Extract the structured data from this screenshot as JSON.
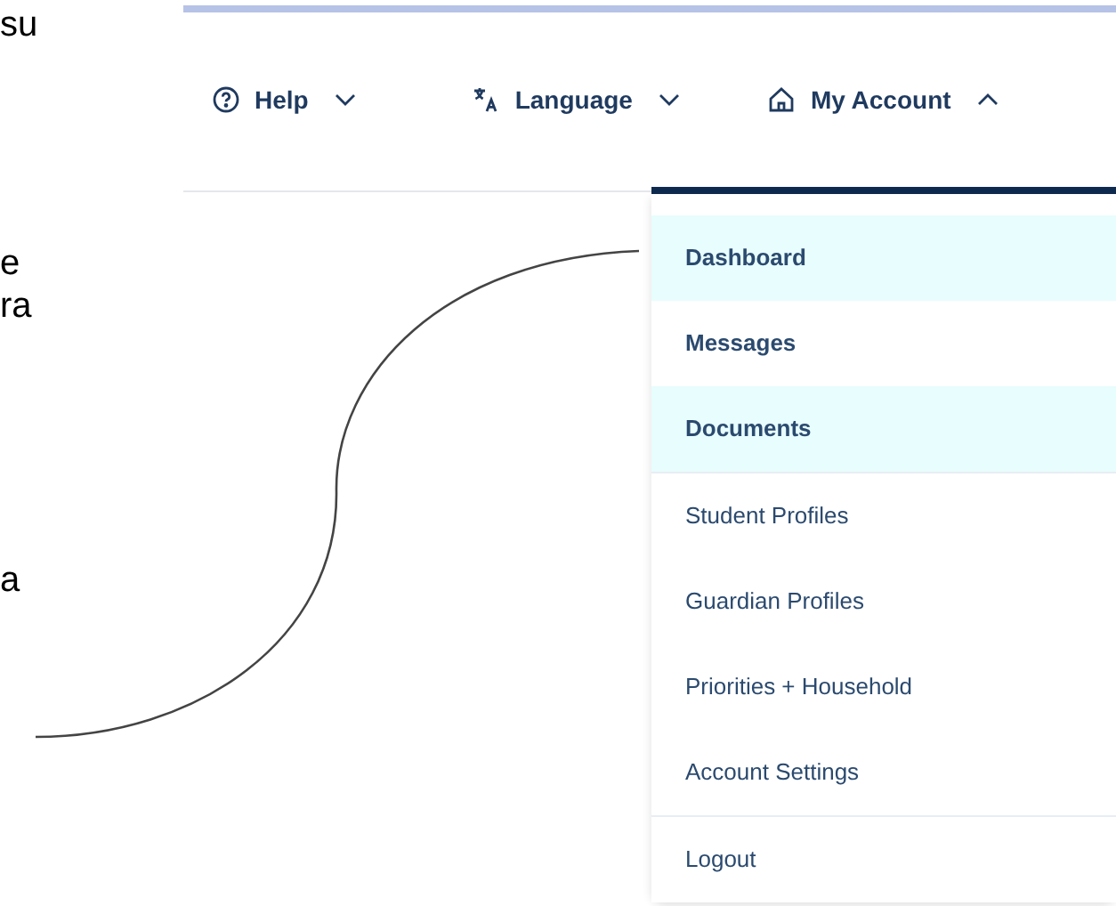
{
  "slide_text": [
    "su",
    "e",
    "ra",
    "a"
  ],
  "nav": [
    {
      "label": "Help",
      "kind": "help",
      "expanded": false
    },
    {
      "label": "Language",
      "kind": "language",
      "expanded": false
    },
    {
      "label": "My Account",
      "kind": "account",
      "expanded": true
    }
  ],
  "menu_groups": [
    [
      {
        "label": "Dashboard",
        "emphasized": true,
        "highlighted": true
      },
      {
        "label": "Messages",
        "emphasized": true,
        "highlighted": false
      },
      {
        "label": "Documents",
        "emphasized": true,
        "highlighted": true
      }
    ],
    [
      {
        "label": "Student Profiles",
        "emphasized": false,
        "highlighted": false
      },
      {
        "label": "Guardian Profiles",
        "emphasized": false,
        "highlighted": false
      },
      {
        "label": "Priorities + Household",
        "emphasized": false,
        "highlighted": false
      },
      {
        "label": "Account Settings",
        "emphasized": false,
        "highlighted": false
      }
    ],
    [
      {
        "label": "Logout",
        "emphasized": false,
        "highlighted": false
      }
    ]
  ]
}
